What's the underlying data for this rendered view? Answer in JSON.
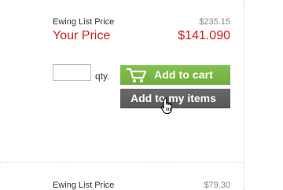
{
  "products": [
    {
      "list_price_label": "Ewing List Price",
      "list_price_value": "$235.15",
      "your_price_label": "Your Price",
      "your_price_value": "$141.090",
      "quantity_value": "",
      "quantity_label": "qty.",
      "add_to_cart_label": "Add to cart",
      "add_to_items_label": "Add to my items"
    },
    {
      "list_price_label": "Ewing List Price",
      "list_price_value": "$79.30"
    }
  ],
  "icons": {
    "cart": "shopping-cart-icon",
    "cursor": "hand-pointer-cursor"
  },
  "colors": {
    "price_red": "#d01f1f",
    "cart_button_green": "#77b644",
    "items_button_gray": "#5f5f5f",
    "list_price_gray": "#888888"
  }
}
